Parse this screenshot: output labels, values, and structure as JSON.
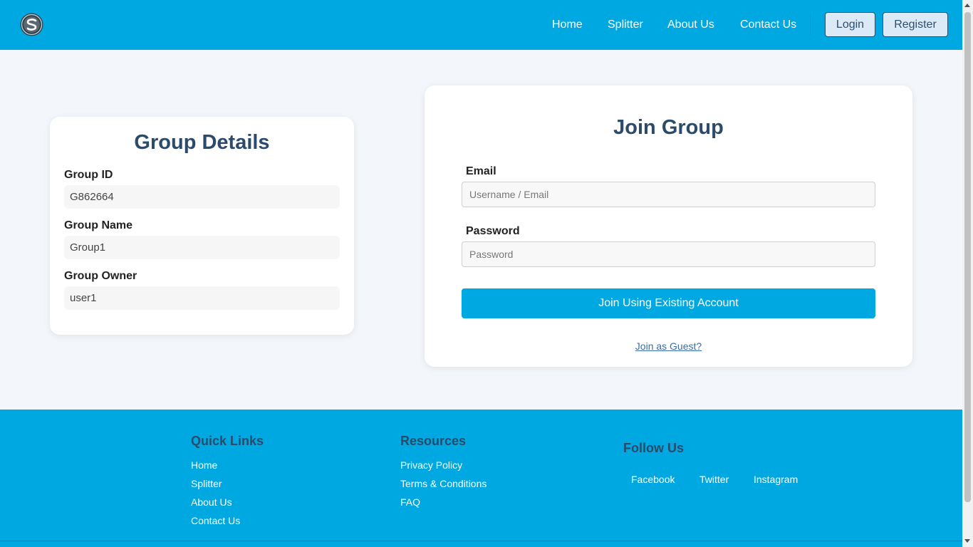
{
  "header": {
    "nav": [
      {
        "label": "Home"
      },
      {
        "label": "Splitter"
      },
      {
        "label": "About Us"
      },
      {
        "label": "Contact Us"
      }
    ],
    "login_label": "Login",
    "register_label": "Register"
  },
  "group_details": {
    "title": "Group Details",
    "fields": [
      {
        "label": "Group ID",
        "value": "G862664"
      },
      {
        "label": "Group Name",
        "value": "Group1"
      },
      {
        "label": "Group Owner",
        "value": "user1"
      }
    ]
  },
  "join_group": {
    "title": "Join Group",
    "email_label": "Email",
    "email_placeholder": "Username / Email",
    "password_label": "Password",
    "password_placeholder": "Password",
    "submit_label": "Join Using Existing Account",
    "guest_link": "Join as Guest?"
  },
  "footer": {
    "quick_links": {
      "heading": "Quick Links",
      "items": [
        "Home",
        "Splitter",
        "About Us",
        "Contact Us"
      ]
    },
    "resources": {
      "heading": "Resources",
      "items": [
        "Privacy Policy",
        "Terms & Conditions",
        "FAQ"
      ]
    },
    "follow_us": {
      "heading": "Follow Us",
      "items": [
        "Facebook",
        "Twitter",
        "Instagram"
      ]
    }
  },
  "colors": {
    "brand": "#00a8e1",
    "heading": "#2c4a6a",
    "background": "#f3f6fa"
  }
}
